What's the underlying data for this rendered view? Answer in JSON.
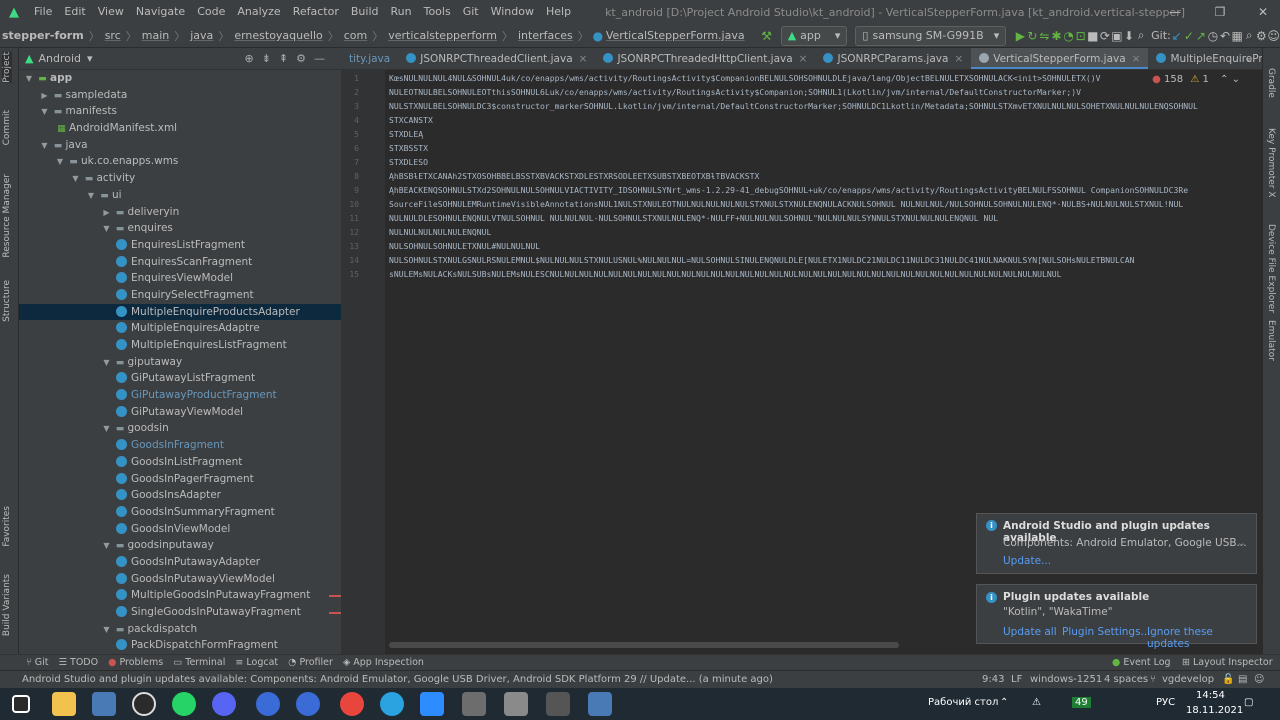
{
  "menu": {
    "items": [
      "File",
      "Edit",
      "View",
      "Navigate",
      "Code",
      "Analyze",
      "Refactor",
      "Build",
      "Run",
      "Tools",
      "Git",
      "Window",
      "Help"
    ],
    "window_title": "kt_android [D:\\Project Android Studio\\kt_android] - VerticalStepperForm.java [kt_android.vertical-stepper]"
  },
  "breadcrumb": [
    "stepper-form",
    "src",
    "main",
    "java",
    "ernestoyaquello",
    "com",
    "verticalstepperform",
    "interfaces",
    "VerticalStepperForm.java"
  ],
  "run_config": {
    "module": "app",
    "device": "samsung SM-G991B",
    "git_label": "Git:"
  },
  "project_panel": {
    "view_mode": "Android",
    "tree": [
      {
        "label": "app",
        "depth": 0,
        "type": "module",
        "open": true
      },
      {
        "label": "sampledata",
        "depth": 1,
        "type": "folder",
        "open": false
      },
      {
        "label": "manifests",
        "depth": 1,
        "type": "folder",
        "open": true
      },
      {
        "label": "AndroidManifest.xml",
        "depth": 2,
        "type": "xml"
      },
      {
        "label": "java",
        "depth": 1,
        "type": "folder",
        "open": true
      },
      {
        "label": "uk.co.enapps.wms",
        "depth": 2,
        "type": "pkg",
        "open": true
      },
      {
        "label": "activity",
        "depth": 3,
        "type": "pkg",
        "open": true
      },
      {
        "label": "ui",
        "depth": 4,
        "type": "pkg",
        "open": true
      },
      {
        "label": "deliveryin",
        "depth": 5,
        "type": "pkg",
        "open": false
      },
      {
        "label": "enquires",
        "depth": 5,
        "type": "pkg",
        "open": true
      },
      {
        "label": "EnquiresListFragment",
        "depth": 6,
        "type": "class"
      },
      {
        "label": "EnquiresScanFragment",
        "depth": 6,
        "type": "class"
      },
      {
        "label": "EnquiresViewModel",
        "depth": 6,
        "type": "class"
      },
      {
        "label": "EnquirySelectFragment",
        "depth": 6,
        "type": "class"
      },
      {
        "label": "MultipleEnquireProductsAdapter",
        "depth": 6,
        "type": "class",
        "selected": true
      },
      {
        "label": "MultipleEnquiresAdaptre",
        "depth": 6,
        "type": "class"
      },
      {
        "label": "MultipleEnquiresListFragment",
        "depth": 6,
        "type": "class"
      },
      {
        "label": "giputaway",
        "depth": 5,
        "type": "pkg",
        "open": true
      },
      {
        "label": "GiPutawayListFragment",
        "depth": 6,
        "type": "class"
      },
      {
        "label": "GiPutawayProductFragment",
        "depth": 6,
        "type": "class",
        "modified": true
      },
      {
        "label": "GiPutawayViewModel",
        "depth": 6,
        "type": "class"
      },
      {
        "label": "goodsin",
        "depth": 5,
        "type": "pkg",
        "open": true
      },
      {
        "label": "GoodsInFragment",
        "depth": 6,
        "type": "class",
        "modified": true
      },
      {
        "label": "GoodsInListFragment",
        "depth": 6,
        "type": "class"
      },
      {
        "label": "GoodsInPagerFragment",
        "depth": 6,
        "type": "class"
      },
      {
        "label": "GoodsInsAdapter",
        "depth": 6,
        "type": "class"
      },
      {
        "label": "GoodsInSummaryFragment",
        "depth": 6,
        "type": "class"
      },
      {
        "label": "GoodsInViewModel",
        "depth": 6,
        "type": "class"
      },
      {
        "label": "goodsinputaway",
        "depth": 5,
        "type": "pkg",
        "open": true
      },
      {
        "label": "GoodsInPutawayAdapter",
        "depth": 6,
        "type": "class"
      },
      {
        "label": "GoodsInPutawayViewModel",
        "depth": 6,
        "type": "class"
      },
      {
        "label": "MultipleGoodsInPutawayFragment",
        "depth": 6,
        "type": "class",
        "error": true
      },
      {
        "label": "SingleGoodsInPutawayFragment",
        "depth": 6,
        "type": "class",
        "error": true
      },
      {
        "label": "packdispatch",
        "depth": 5,
        "type": "pkg",
        "open": true
      },
      {
        "label": "PackDispatchFormFragment",
        "depth": 6,
        "type": "class"
      }
    ]
  },
  "side_tools_left": [
    "Project",
    "Commit",
    "Resource Manager",
    "Structure",
    "Favorites",
    "Build Variants"
  ],
  "side_tools_right": [
    "Gradle",
    "Key Promoter X",
    "Device File Explorer",
    "Emulator"
  ],
  "editor": {
    "tabs": [
      {
        "label": "tity.java",
        "active": false
      },
      {
        "label": "JSONRPCThreadedClient.java",
        "active": false
      },
      {
        "label": "JSONRPCThreadedHttpClient.java",
        "active": false
      },
      {
        "label": "JSONRPCParams.java",
        "active": false
      },
      {
        "label": "VerticalStepperForm.java",
        "active": true
      },
      {
        "label": "MultipleEnquireProductsAdapter.kt",
        "active": false
      }
    ],
    "warnings": "158",
    "weak_warnings": "1",
    "line_numbers": [
      "1",
      "2",
      "3",
      "4",
      "5",
      "6",
      "7",
      "8",
      "9",
      "10",
      "11",
      "12",
      "13",
      "14",
      "15"
    ],
    "lines": [
      "KœsNULNULNUL4NUL&SOHNUL4uk/co/enapps/wms/activity/RoutingsActivity$CompanionBELNULSOHSOHNULDLEjava/lang/ObjectBELNULETXSOHNULACK<init>SOHNULETX()V",
      "NULEOTNULBELSOHNULEOTthisSOHNUL6Luk/co/enapps/wms/activity/RoutingsActivity$Companion;SOHNUL1(Lkotlin/jvm/internal/DefaultConstructorMarker;)V",
      "NULSTXNULBELSOHNULDC3$constructor_markerSOHNUL.Lkotlin/jvm/internal/DefaultConstructorMarker;SOHNULDC1Lkotlin/Metadata;SOHNULSTXmvETXNULNULNULSOHETXNULNULNULENQSOHNUL",
      "STXCANSTX",
      "STXDLEĄ",
      "STXBSSTX",
      "STXDLESO",
      "ĄhBSBƚETXCANAh2STXOSOHBBELBSSTXBVACKSTXDLESTXRSODLEETXSUBSTXBEOTXBƚTBVACKSTX",
      "ĄhBEACKENQSOHNULSTXd2SOHNULNULSOHNULVIACTIVITY_IDSOHNULSYNrt_wms-1.2.29-41_debugSOHNUL+uk/co/enapps/wms/activity/RoutingsActivityBELNULFSSOHNUL  CompanionSOHNULDC3Re",
      "SourceFileSOHNULEMRuntimeVisibleAnnotationsNUL1NULSTXNULEOTNULNULNULNULNULSTXNULSTXNULENQNULACKNULSOHNUL NULNULNUL/NULSOHNULSOHNULNULENQ*·NULBS+NULNULNULSTXNUL!NUL",
      "NULNULDLESOHNULENQNULVTNULSOHNUL NULNULNUL-NULSOHNULSTXNULNULENQ*·NULFF+NULNULNULSOHNUL\"NULNULNULSYNNULSTXNULNULNULENQNUL NUL",
      "NULNULNULNULNULENQNUL",
      "NULSOHNULSOHNULETXNUL#NULNULNUL",
      "NULSOHNULSTXNULGSNULRSNULEMNUL$NULNULNULSTXNULUSNUL%NULNULNUL=NULSOHNULSINULENQNULDLE[NULETX1NULDC21NULDC11NULDC31NULDC41NULNAKNULSYN[NULSOHsNULETBNULCAN",
      "sNULEMsNULACKsNULSUBsNULEMsNULESCNULNULNULNULNULNULNULNULNULNULNULNULNULNULNULNULNULNULNULNULNULNULNULNULNULNULNULNULNULNULNULNULNULNULNUL"
    ]
  },
  "notifications": [
    {
      "title": "Android Studio and plugin updates available",
      "body": "Components: Android Emulator, Google USB...",
      "links": [
        "Update..."
      ]
    },
    {
      "title": "Plugin updates available",
      "body": "\"Kotlin\", \"WakaTime\"",
      "links": [
        "Update all",
        "Plugin Settings...",
        "Ignore these updates"
      ]
    }
  ],
  "tool_windows": [
    "Git",
    "TODO",
    "Problems",
    "Terminal",
    "Logcat",
    "Profiler",
    "App Inspection"
  ],
  "tool_windows_right": [
    "Event Log",
    "Layout Inspector"
  ],
  "status_bar": {
    "message": "Android Studio and plugin updates available: Components: Android Emulator, Google USB Driver, Android SDK Platform 29 // Update... (a minute ago)",
    "position": "9:43",
    "line_sep": "LF",
    "encoding": "windows-1251",
    "indent": "4 spaces",
    "branch": "vgdevelop"
  },
  "taskbar": {
    "desktop_label": "Рабочий стол",
    "lang": "РУС",
    "time": "14:54",
    "date": "18.11.2021",
    "badge": "49"
  },
  "colors": {
    "accent": "#4a88c7",
    "selection": "#0d293e",
    "panel": "#3c3f41",
    "editor": "#2b2b2b",
    "error": "#c75450",
    "link": "#589df6"
  }
}
